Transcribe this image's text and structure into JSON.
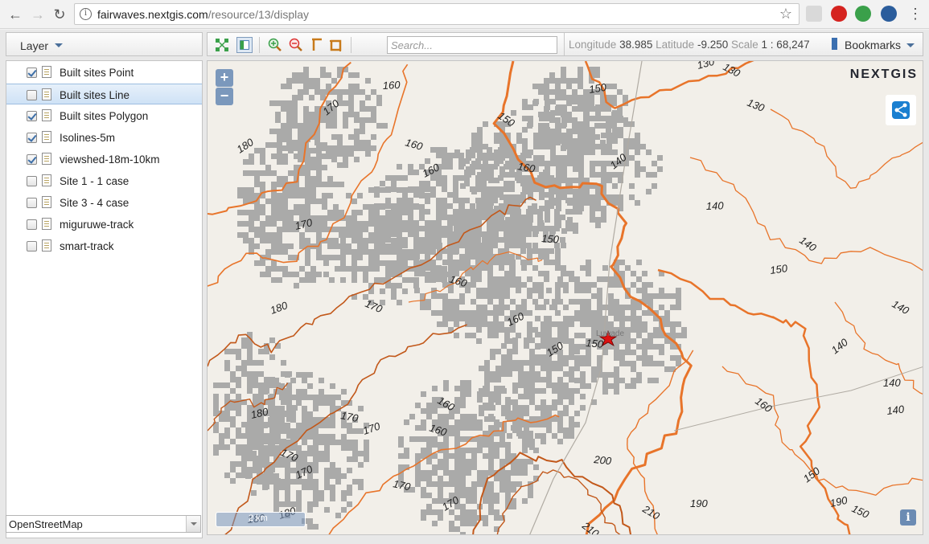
{
  "browser": {
    "url_host": "fairwaves.nextgis.com",
    "url_path": "/resource/13/display",
    "info_glyph": "i",
    "back_icon": "back-arrow-icon",
    "forward_icon": "forward-arrow-icon",
    "reload_icon": "reload-icon",
    "star_icon": "bookmark-star-icon"
  },
  "layers_panel": {
    "header": "Layer",
    "items": [
      {
        "label": "Built sites Point",
        "checked": true,
        "selected": false
      },
      {
        "label": "Built sites Line",
        "checked": false,
        "selected": true
      },
      {
        "label": "Built sites Polygon",
        "checked": true,
        "selected": false
      },
      {
        "label": "Isolines-5m",
        "checked": true,
        "selected": false
      },
      {
        "label": "viewshed-18m-10km",
        "checked": true,
        "selected": false
      },
      {
        "label": "Site 1 - 1 case",
        "checked": false,
        "selected": false
      },
      {
        "label": "Site 3 - 4 case",
        "checked": false,
        "selected": false
      },
      {
        "label": "miguruwe-track",
        "checked": false,
        "selected": false
      },
      {
        "label": "smart-track",
        "checked": false,
        "selected": false
      }
    ],
    "basemap": "OpenStreetMap"
  },
  "toolbar": {
    "search_placeholder": "Search...",
    "longitude_label": "Longitude",
    "longitude_value": "38.985",
    "latitude_label": "Latitude",
    "latitude_value": "-9.250",
    "scale_label": "Scale",
    "scale_value": "1 : 68,247",
    "bookmarks_label": "Bookmarks"
  },
  "map": {
    "logo": "NEXTGIS",
    "zoom_in": "+",
    "zoom_out": "−",
    "scale_text": "2 km",
    "place_label": "Luwade",
    "info_label": "i",
    "contour_labels": [
      "170",
      "160",
      "150",
      "150",
      "130",
      "130",
      "130",
      "140",
      "160",
      "160",
      "160",
      "180",
      "150",
      "140",
      "140",
      "140",
      "150",
      "140",
      "170",
      "170",
      "180",
      "160",
      "160",
      "170",
      "150",
      "150",
      "140",
      "140",
      "160",
      "140",
      "160",
      "180",
      "170",
      "170",
      "160",
      "170",
      "170",
      "170",
      "200",
      "150",
      "190",
      "210",
      "180",
      "210",
      "190",
      "150",
      "180"
    ],
    "colors": {
      "contour": "#e8742a",
      "contour_dark": "#c2581a",
      "viewshed": "#a3a3a3",
      "ground": "#f2efe9"
    }
  }
}
